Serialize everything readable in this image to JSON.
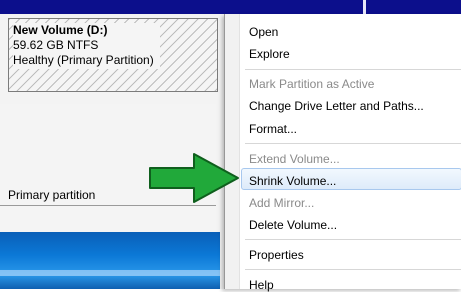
{
  "volume": {
    "name": "New Volume  (D:)",
    "size": "59.62 GB NTFS",
    "status": "Healthy (Primary Partition)"
  },
  "legend": {
    "label": "Primary partition"
  },
  "context_menu": {
    "items": [
      {
        "label": "Open",
        "enabled": true
      },
      {
        "label": "Explore",
        "enabled": true
      },
      {
        "label": "Mark Partition as Active",
        "enabled": false
      },
      {
        "label": "Change Drive Letter and Paths...",
        "enabled": true
      },
      {
        "label": "Format...",
        "enabled": true
      },
      {
        "label": "Extend Volume...",
        "enabled": false
      },
      {
        "label": "Shrink Volume...",
        "enabled": true,
        "highlighted": true
      },
      {
        "label": "Add Mirror...",
        "enabled": false
      },
      {
        "label": "Delete Volume...",
        "enabled": true
      },
      {
        "label": "Properties",
        "enabled": true
      },
      {
        "label": "Help",
        "enabled": true
      }
    ]
  },
  "colors": {
    "arrow_fill": "#21a93a",
    "highlight_border": "#a8c8ee",
    "disabled_text": "#8a8a8a",
    "title_strip": "#0c0f8c"
  },
  "icons": {
    "pointer": "green-arrow-icon"
  }
}
